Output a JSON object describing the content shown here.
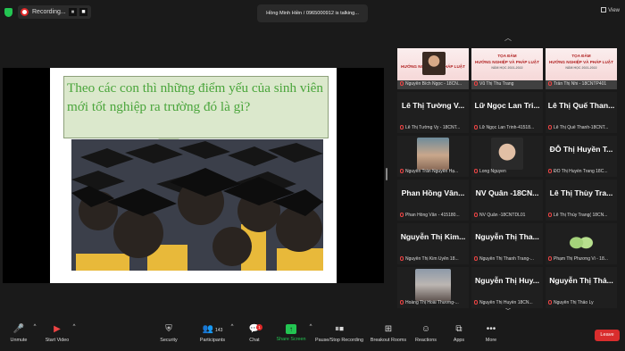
{
  "top_bar": {
    "recording_label": "Recording...",
    "pause_glyph": "⏸",
    "stop_glyph": "■",
    "talking_text": "Hồng Minh Hiền / 0965000912 is talking...",
    "view_label": "View"
  },
  "slide": {
    "question": "Theo các con thì những điểm yếu của sinh viên mới tốt nghiệp ra trường đó là gì?"
  },
  "gallery": {
    "up_glyph": "︿",
    "down_glyph": "﹀",
    "tiles": [
      {
        "big": "",
        "caption": "Nguyễn Bích Ngọc - 18CN..."
      },
      {
        "big": "",
        "caption": "Vũ Thị Thu Trang"
      },
      {
        "big": "",
        "caption": "Trần Thị Nhi - 18CNTP401"
      },
      {
        "big": "Lê Thị Tường V...",
        "caption": "Lê Thị Tường Vy - 18CNT..."
      },
      {
        "big": "Lữ Ngọc Lan Tri...",
        "caption": "Lữ Ngọc Lan Trinh-41518..."
      },
      {
        "big": "Lê Thị Quế Than...",
        "caption": "Lê Thị Quế Thanh-18CNT..."
      },
      {
        "big": "",
        "caption": "Nguyễn Trần Nguyên Hạ..."
      },
      {
        "big": "",
        "caption": "Long Nguyen"
      },
      {
        "big": "ĐỖ Thị Huyền T...",
        "caption": "ĐỖ Thị Huyền Trang 18C..."
      },
      {
        "big": "Phan Hồng Vân...",
        "caption": "Phan Hồng Vân - 415180..."
      },
      {
        "big": "NV Quân -18CN...",
        "caption": "NV Quân -18CNTDL01"
      },
      {
        "big": "Lê Thị Thùy Tra...",
        "caption": "Lê Thị Thùy Trang( 18CN..."
      },
      {
        "big": "Nguyễn Thị Kim...",
        "caption": "Nguyễn Thị Kim Uyên 18..."
      },
      {
        "big": "Nguyễn Thị Tha...",
        "caption": "Nguyễn Thị Thanh Trang-..."
      },
      {
        "big": "",
        "caption": "Phạm Thị Phương Vi - 18..."
      },
      {
        "big": "",
        "caption": "Hoàng Thị Hoài Thương-..."
      },
      {
        "big": "Nguyễn Thị Huy...",
        "caption": "Nguyễn Thị Huyền 18CN..."
      },
      {
        "big": "Nguyễn Thị Thả...",
        "caption": "Nguyễn Thị Thảo Ly"
      }
    ],
    "poster_title": "TỌA ĐÀM",
    "poster_subtitle": "HƯỚNG NGHIỆP VÀ PHÁP LUẬT",
    "poster_year": "NĂM HỌC 2021-2022"
  },
  "toolbar": {
    "unmute": "Unmute",
    "start_video": "Start Video",
    "security": "Security",
    "participants": "Participants",
    "participants_count": "143",
    "chat": "Chat",
    "chat_badge": "1",
    "share_screen": "Share Screen",
    "pause_recording": "Pause/Stop Recording",
    "breakout": "Breakout Rooms",
    "reactions": "Reactions",
    "apps": "Apps",
    "more": "More",
    "leave": "Leave",
    "caret": "^"
  },
  "colors": {
    "accent_green": "#23c552",
    "leave_red": "#d92d2d",
    "slide_text_green": "#4aa53b",
    "bubble_fill": "#dbe8cc"
  }
}
